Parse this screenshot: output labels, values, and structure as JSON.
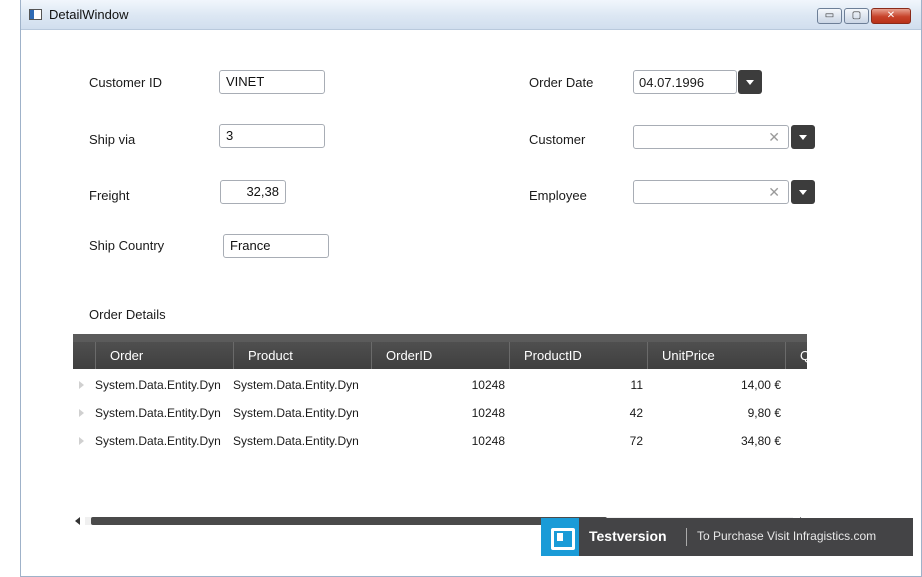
{
  "window": {
    "title": "DetailWindow",
    "min_glyph": "▭",
    "max_glyph": "▢",
    "close_glyph": "✕"
  },
  "form": {
    "customer_id_label": "Customer ID",
    "customer_id_value": "VINET",
    "ship_via_label": "Ship via",
    "ship_via_value": "3",
    "freight_label": "Freight",
    "freight_value": "32,38",
    "ship_country_label": "Ship Country",
    "ship_country_value": "France",
    "order_date_label": "Order Date",
    "order_date_value": "04.07.1996",
    "customer_label": "Customer",
    "customer_value": "",
    "employee_label": "Employee",
    "employee_value": "",
    "clear_glyph": "✕"
  },
  "order_details": {
    "title": "Order Details",
    "columns": [
      "Order",
      "Product",
      "OrderID",
      "ProductID",
      "UnitPrice",
      "Q"
    ],
    "rows": [
      {
        "order": "System.Data.Entity.Dyn",
        "product": "System.Data.Entity.Dyn",
        "order_id": "10248",
        "product_id": "11",
        "unit_price": "14,00 €"
      },
      {
        "order": "System.Data.Entity.Dyn",
        "product": "System.Data.Entity.Dyn",
        "order_id": "10248",
        "product_id": "42",
        "unit_price": "9,80 €"
      },
      {
        "order": "System.Data.Entity.Dyn",
        "product": "System.Data.Entity.Dyn",
        "order_id": "10248",
        "product_id": "72",
        "unit_price": "34,80 €"
      }
    ]
  },
  "banner": {
    "label": "Testversion",
    "purchase_text": "To Purchase Visit Infragistics.com"
  },
  "colors": {
    "grid_header": "#3f3f3f",
    "banner_bg": "#444446",
    "logo_accent": "#1a9bd7",
    "close_button": "#c7422a"
  }
}
